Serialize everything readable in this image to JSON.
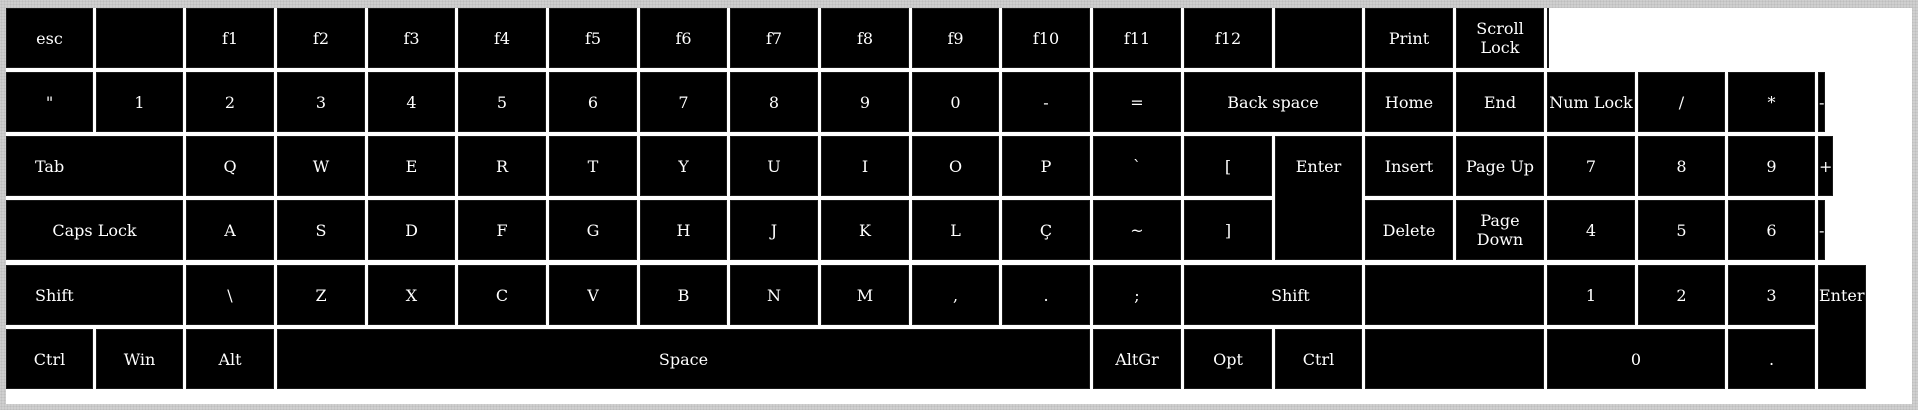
{
  "keyboard": {
    "rows": [
      [
        {
          "id": "esc",
          "label": "esc"
        },
        {
          "id": "blank-1",
          "label": ""
        },
        {
          "id": "f1",
          "label": "f1"
        },
        {
          "id": "f2",
          "label": "f2"
        },
        {
          "id": "f3",
          "label": "f3"
        },
        {
          "id": "f4",
          "label": "f4"
        },
        {
          "id": "f5",
          "label": "f5"
        },
        {
          "id": "f6",
          "label": "f6"
        },
        {
          "id": "f7",
          "label": "f7"
        },
        {
          "id": "f8",
          "label": "f8"
        },
        {
          "id": "f9",
          "label": "f9"
        },
        {
          "id": "f10",
          "label": "f10"
        },
        {
          "id": "f11",
          "label": "f11"
        },
        {
          "id": "f12",
          "label": "f12"
        },
        {
          "id": "blank-2",
          "label": ""
        },
        {
          "id": "print",
          "label": "Print"
        },
        {
          "id": "scroll-lock",
          "label": "Scroll\nLock"
        },
        {
          "id": "blank-3",
          "label": ""
        }
      ],
      [
        {
          "id": "quote",
          "label": "\""
        },
        {
          "id": "digit-1",
          "label": "1"
        },
        {
          "id": "digit-2",
          "label": "2"
        },
        {
          "id": "digit-3",
          "label": "3"
        },
        {
          "id": "digit-4",
          "label": "4"
        },
        {
          "id": "digit-5",
          "label": "5"
        },
        {
          "id": "digit-6",
          "label": "6"
        },
        {
          "id": "digit-7",
          "label": "7"
        },
        {
          "id": "digit-8",
          "label": "8"
        },
        {
          "id": "digit-9",
          "label": "9"
        },
        {
          "id": "digit-0",
          "label": "0"
        },
        {
          "id": "minus",
          "label": "-"
        },
        {
          "id": "equals",
          "label": "="
        },
        {
          "id": "backspace",
          "label": "Back space"
        },
        {
          "id": "home",
          "label": "Home"
        },
        {
          "id": "end",
          "label": "End"
        },
        {
          "id": "num-lock",
          "label": "Num Lock"
        },
        {
          "id": "numpad-divide",
          "label": "/"
        },
        {
          "id": "numpad-multiply",
          "label": "*"
        },
        {
          "id": "numpad-minus",
          "label": "-"
        }
      ],
      [
        {
          "id": "tab",
          "label": "Tab"
        },
        {
          "id": "q",
          "label": "Q"
        },
        {
          "id": "w",
          "label": "W"
        },
        {
          "id": "e",
          "label": "E"
        },
        {
          "id": "r",
          "label": "R"
        },
        {
          "id": "t",
          "label": "T"
        },
        {
          "id": "y",
          "label": "Y"
        },
        {
          "id": "u",
          "label": "U"
        },
        {
          "id": "i",
          "label": "I"
        },
        {
          "id": "o",
          "label": "O"
        },
        {
          "id": "p",
          "label": "P"
        },
        {
          "id": "backtick",
          "label": "`"
        },
        {
          "id": "open-bracket",
          "label": "["
        },
        {
          "id": "enter",
          "label": "Enter"
        },
        {
          "id": "insert",
          "label": "Insert"
        },
        {
          "id": "page-up",
          "label": "Page Up"
        },
        {
          "id": "numpad-7",
          "label": "7"
        },
        {
          "id": "numpad-8",
          "label": "8"
        },
        {
          "id": "numpad-9",
          "label": "9"
        },
        {
          "id": "numpad-plus",
          "label": "+"
        }
      ],
      [
        {
          "id": "caps-lock",
          "label": "Caps Lock"
        },
        {
          "id": "a",
          "label": "A"
        },
        {
          "id": "s",
          "label": "S"
        },
        {
          "id": "d",
          "label": "D"
        },
        {
          "id": "f",
          "label": "F"
        },
        {
          "id": "g",
          "label": "G"
        },
        {
          "id": "h",
          "label": "H"
        },
        {
          "id": "j",
          "label": "J"
        },
        {
          "id": "k",
          "label": "K"
        },
        {
          "id": "l",
          "label": "L"
        },
        {
          "id": "c-cedilla",
          "label": "Ç"
        },
        {
          "id": "tilde",
          "label": "~"
        },
        {
          "id": "close-bracket",
          "label": "]"
        },
        {
          "id": "delete",
          "label": "Delete"
        },
        {
          "id": "page-down",
          "label": "Page\nDown"
        },
        {
          "id": "numpad-4",
          "label": "4"
        },
        {
          "id": "numpad-5",
          "label": "5"
        },
        {
          "id": "numpad-6",
          "label": "6"
        },
        {
          "id": "numpad-minus-2",
          "label": "-"
        }
      ],
      [
        {
          "id": "left-shift",
          "label": "Shift"
        },
        {
          "id": "backslash",
          "label": "\\"
        },
        {
          "id": "z",
          "label": "Z"
        },
        {
          "id": "x",
          "label": "X"
        },
        {
          "id": "c",
          "label": "C"
        },
        {
          "id": "v",
          "label": "V"
        },
        {
          "id": "b",
          "label": "B"
        },
        {
          "id": "n",
          "label": "N"
        },
        {
          "id": "m",
          "label": "M"
        },
        {
          "id": "comma",
          "label": ","
        },
        {
          "id": "period",
          "label": "."
        },
        {
          "id": "semicolon",
          "label": ";"
        },
        {
          "id": "right-shift",
          "label": "Shift"
        },
        {
          "id": "blank-4",
          "label": ""
        },
        {
          "id": "numpad-1",
          "label": "1"
        },
        {
          "id": "numpad-2",
          "label": "2"
        },
        {
          "id": "numpad-3",
          "label": "3"
        },
        {
          "id": "numpad-enter",
          "label": "Enter"
        }
      ],
      [
        {
          "id": "left-ctrl",
          "label": "Ctrl"
        },
        {
          "id": "win",
          "label": "Win"
        },
        {
          "id": "alt",
          "label": "Alt"
        },
        {
          "id": "space",
          "label": "Space"
        },
        {
          "id": "altgr",
          "label": "AltGr"
        },
        {
          "id": "opt",
          "label": "Opt"
        },
        {
          "id": "right-ctrl",
          "label": "Ctrl"
        },
        {
          "id": "blank-5",
          "label": ""
        },
        {
          "id": "numpad-0",
          "label": "0"
        },
        {
          "id": "numpad-decimal",
          "label": "."
        }
      ]
    ]
  }
}
